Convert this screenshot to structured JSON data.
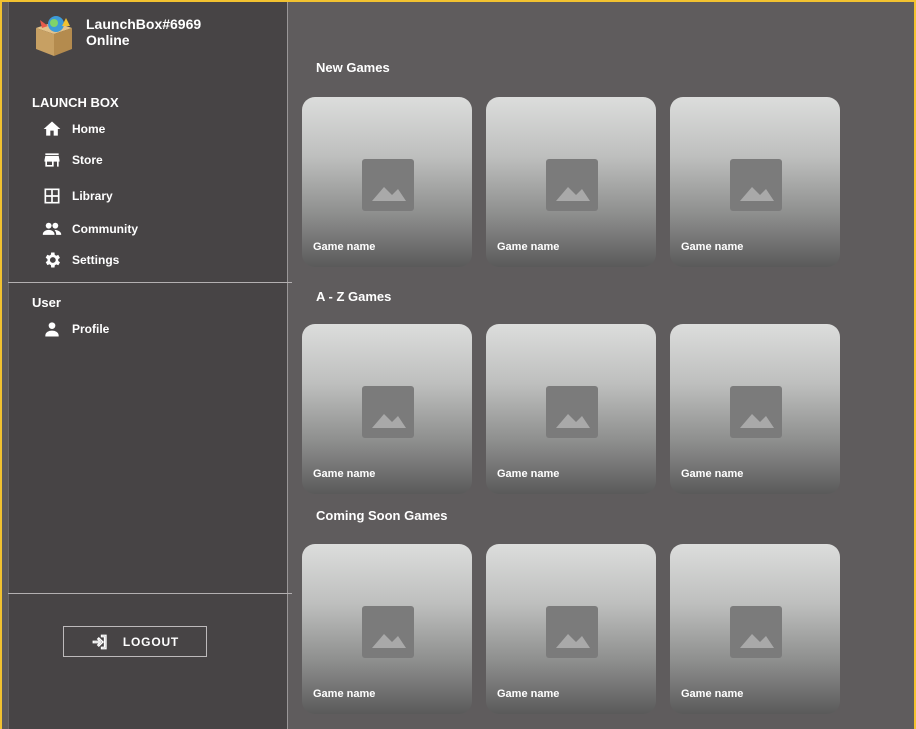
{
  "user": {
    "name": "LaunchBox#6969",
    "status": "Online"
  },
  "sidebar": {
    "launchbox_heading": "LAUNCH BOX",
    "items": [
      {
        "label": "Home",
        "icon": "home-icon"
      },
      {
        "label": "Store",
        "icon": "store-icon"
      },
      {
        "label": "Library",
        "icon": "library-icon"
      },
      {
        "label": "Community",
        "icon": "community-icon"
      },
      {
        "label": "Settings",
        "icon": "gear-icon"
      }
    ],
    "user_heading": "User",
    "user_items": [
      {
        "label": "Profile",
        "icon": "person-icon"
      }
    ],
    "logout_label": "LOGOUT"
  },
  "sections": [
    {
      "title": "New Games",
      "games": [
        "Game name",
        "Game name",
        "Game name"
      ]
    },
    {
      "title": "A - Z Games",
      "games": [
        "Game name",
        "Game name",
        "Game name"
      ]
    },
    {
      "title": "Coming Soon Games",
      "games": [
        "Game name",
        "Game name",
        "Game name"
      ]
    }
  ],
  "colors": {
    "sidebar_bg": "#474445",
    "main_bg": "#5f5c5d",
    "frame_accent": "#f2c230"
  }
}
